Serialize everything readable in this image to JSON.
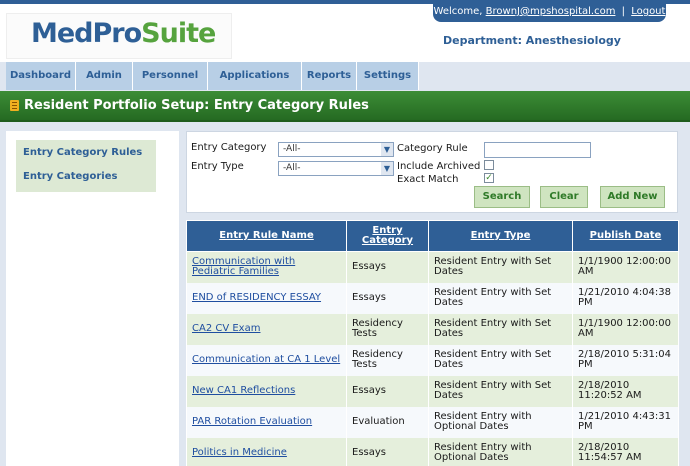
{
  "header": {
    "logo_part1": "MedPro",
    "logo_part2": "Suite",
    "welcome_text": "Welcome,",
    "user_email": "BrownJ@mpshospital.com",
    "separator": "|",
    "logout_label": "Logout",
    "department": "Department: Anesthesiology"
  },
  "nav": {
    "tabs": [
      "Dashboard",
      "Admin",
      "Personnel",
      "Applications",
      "Reports",
      "Settings"
    ]
  },
  "page": {
    "title": "Resident Portfolio Setup: Entry Category Rules"
  },
  "sidebar": {
    "items": [
      "Entry Category Rules",
      "Entry Categories"
    ]
  },
  "filter": {
    "entry_category_label": "Entry Category",
    "entry_category_value": "-All-",
    "entry_type_label": "Entry Type",
    "entry_type_value": "-All-",
    "category_rule_label": "Category Rule",
    "category_rule_value": "",
    "include_archived_label": "Include Archived",
    "include_archived_checked": false,
    "exact_match_label": "Exact Match",
    "exact_match_checked": true,
    "search_label": "Search",
    "clear_label": "Clear",
    "add_new_label": "Add New"
  },
  "table": {
    "columns": [
      "Entry Rule Name",
      "Entry Category",
      "Entry Type",
      "Publish Date"
    ],
    "rows": [
      {
        "name": "Communication with Pediatric Families",
        "category": "Essays",
        "type": "Resident Entry with Set Dates",
        "date": "1/1/1900 12:00:00 AM"
      },
      {
        "name": "END of RESIDENCY ESSAY",
        "category": "Essays",
        "type": "Resident Entry with Set Dates",
        "date": "1/21/2010 4:04:38 PM"
      },
      {
        "name": "CA2 CV Exam",
        "category": "Residency Tests",
        "type": "Resident Entry with Set Dates",
        "date": "1/1/1900 12:00:00 AM"
      },
      {
        "name": "Communication at CA 1 Level",
        "category": "Residency Tests",
        "type": "Resident Entry with Set Dates",
        "date": "2/18/2010 5:31:04 PM"
      },
      {
        "name": "New CA1 Reflections",
        "category": "Essays",
        "type": "Resident Entry with Set Dates",
        "date": "2/18/2010 11:20:52 AM"
      },
      {
        "name": "PAR Rotation Evaluation",
        "category": "Evaluation",
        "type": "Resident Entry with Optional Dates",
        "date": "1/21/2010 4:43:31 PM"
      },
      {
        "name": "Politics in Medicine",
        "category": "Essays",
        "type": "Resident Entry with Optional Dates",
        "date": "2/18/2010 11:54:57 AM"
      }
    ]
  },
  "icons": {
    "title_icon": "document-icon",
    "dropdown_icon": "chevron-down-icon",
    "check_icon": "checkmark-icon"
  },
  "colors": {
    "brand_blue": "#2f5f96",
    "brand_green": "#56a33e",
    "title_green": "#2f7d2b"
  }
}
